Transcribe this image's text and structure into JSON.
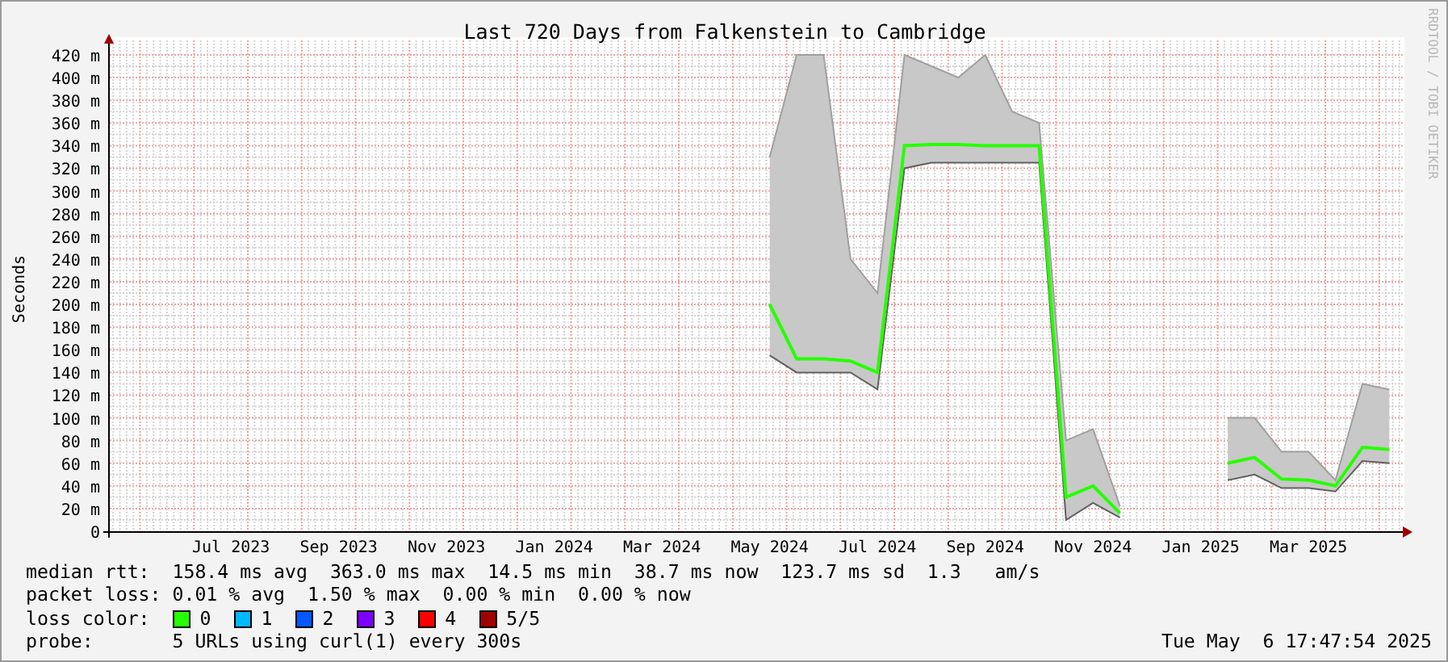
{
  "title": "Last 720 Days from Falkenstein to Cambridge",
  "credit": "RRDTOOL / TOBI OETIKER",
  "chart_data": {
    "type": "line",
    "grid": true,
    "ylabel": "Seconds",
    "ylim": [
      0,
      420
    ],
    "categories": [
      null,
      null,
      null,
      null,
      "Jul 2023",
      null,
      null,
      null,
      "Sep 2023",
      null,
      null,
      null,
      "Nov 2023",
      null,
      null,
      null,
      "Jan 2024",
      null,
      null,
      null,
      "Mar 2024",
      null,
      null,
      null,
      "May 2024",
      null,
      null,
      null,
      "Jul 2024",
      null,
      null,
      null,
      "Sep 2024",
      null,
      null,
      null,
      "Nov 2024",
      null,
      null,
      null,
      "Jan 2025",
      null,
      null,
      null,
      "Mar 2025",
      null,
      null,
      null
    ],
    "series": [
      {
        "color": "#a0a0a0",
        "values": [
          null,
          null,
          null,
          null,
          null,
          null,
          null,
          null,
          null,
          null,
          null,
          null,
          null,
          null,
          null,
          null,
          null,
          null,
          null,
          null,
          null,
          null,
          null,
          null,
          330,
          420,
          420,
          240,
          210,
          420,
          410,
          400,
          420,
          370,
          360,
          80,
          90,
          22,
          null,
          null,
          null,
          100,
          100,
          70,
          70,
          45,
          130,
          125
        ]
      },
      {
        "color": "#606060",
        "values": [
          null,
          null,
          null,
          null,
          null,
          null,
          null,
          null,
          null,
          null,
          null,
          null,
          null,
          null,
          null,
          null,
          null,
          null,
          null,
          null,
          null,
          null,
          null,
          null,
          155,
          140,
          140,
          140,
          125,
          320,
          325,
          325,
          325,
          325,
          325,
          10,
          25,
          12,
          null,
          null,
          null,
          45,
          50,
          38,
          38,
          35,
          62,
          60
        ]
      },
      {
        "color": "#26ff00",
        "values": [
          null,
          null,
          null,
          null,
          null,
          null,
          null,
          null,
          null,
          null,
          null,
          null,
          null,
          null,
          null,
          null,
          null,
          null,
          null,
          null,
          null,
          null,
          null,
          null,
          200,
          152,
          152,
          150,
          140,
          340,
          341,
          341,
          340,
          340,
          340,
          30,
          40,
          16,
          null,
          null,
          null,
          60,
          65,
          46,
          45,
          40,
          74,
          72
        ]
      }
    ],
    "yticks": [
      {
        "value": 0,
        "label": "0"
      },
      {
        "value": 20,
        "label": "20 m"
      },
      {
        "value": 40,
        "label": "40 m"
      },
      {
        "value": 60,
        "label": "60 m"
      },
      {
        "value": 80,
        "label": "80 m"
      },
      {
        "value": 100,
        "label": "100 m"
      },
      {
        "value": 120,
        "label": "120 m"
      },
      {
        "value": 140,
        "label": "140 m"
      },
      {
        "value": 160,
        "label": "160 m"
      },
      {
        "value": 180,
        "label": "180 m"
      },
      {
        "value": 200,
        "label": "200 m"
      },
      {
        "value": 220,
        "label": "220 m"
      },
      {
        "value": 240,
        "label": "240 m"
      },
      {
        "value": 260,
        "label": "260 m"
      },
      {
        "value": 280,
        "label": "280 m"
      },
      {
        "value": 300,
        "label": "300 m"
      },
      {
        "value": 320,
        "label": "320 m"
      },
      {
        "value": 340,
        "label": "340 m"
      },
      {
        "value": 360,
        "label": "360 m"
      },
      {
        "value": 380,
        "label": "380 m"
      },
      {
        "value": 400,
        "label": "400 m"
      },
      {
        "value": 420,
        "label": "420 m"
      }
    ]
  },
  "stats": [
    {
      "label": "median rtt:",
      "text": "158.4 ms avg  363.0 ms max  14.5 ms min  38.7 ms now  123.7 ms sd  1.3   am/s"
    },
    {
      "label": "packet loss:",
      "text": "0.01 % avg  1.50 % max  0.00 % min  0.00 % now"
    }
  ],
  "loss_color": {
    "label": "loss color:",
    "items": [
      {
        "label": "0",
        "color": "#26ff00"
      },
      {
        "label": "1",
        "color": "#00b8ff"
      },
      {
        "label": "2",
        "color": "#0059ff"
      },
      {
        "label": "3",
        "color": "#7e00ff"
      },
      {
        "label": "4",
        "color": "#ff0000"
      },
      {
        "label": "5/5",
        "color": "#a10000"
      }
    ]
  },
  "probe": {
    "label": "probe:",
    "text": "5 URLs using curl(1) every 300s",
    "timestamp": "Tue May  6 17:47:54 2025"
  }
}
